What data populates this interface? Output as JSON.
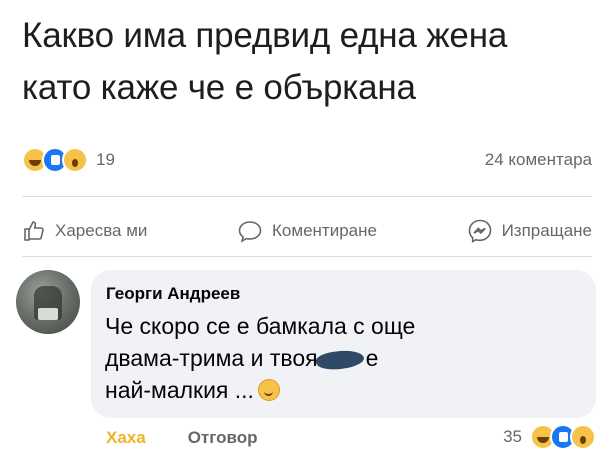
{
  "post": {
    "lines": [
      "Какво има предвид една жена",
      "като каже че е объркана"
    ]
  },
  "stats": {
    "reaction_icons": [
      "haha-icon",
      "like-icon",
      "wow-icon"
    ],
    "reaction_count": "19",
    "comment_count": "24 коментара"
  },
  "actions": {
    "like": "Харесва ми",
    "comment": "Коментиране",
    "share": "Изпращане"
  },
  "comment": {
    "author": "Георги Андреев",
    "line1": "Че скоро се е бамкала с още",
    "line2_before": "двама-трима и твоя",
    "line2_after": "е",
    "line3": "най-малкия ...",
    "reply_actions": {
      "like": "Хаха",
      "reply": "Отговор"
    },
    "reaction_count": "35"
  },
  "colors": {
    "text": "#1c1e21",
    "secondary": "#65676b",
    "bubble": "#f0f2f5",
    "like_blue": "#1877f2",
    "emoji_yellow": "#f7c24a"
  }
}
